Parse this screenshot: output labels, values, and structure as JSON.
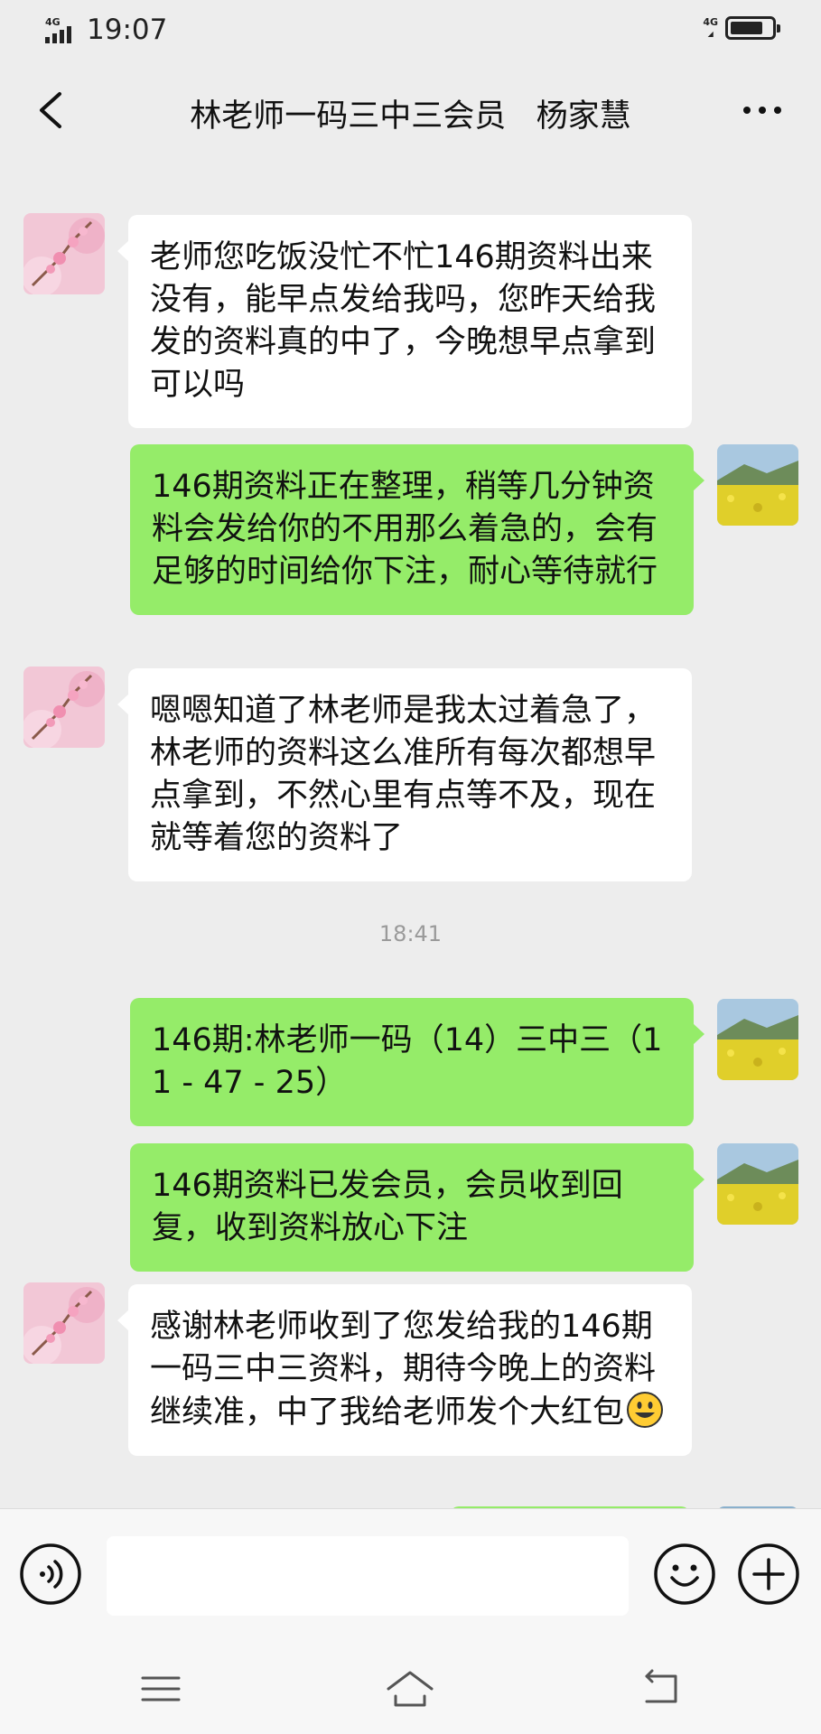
{
  "status_bar": {
    "time": "19:07",
    "signal_label": "4G",
    "battery_label": "4G"
  },
  "header": {
    "title": "林老师一码三中三会员   杨家慧"
  },
  "chat": {
    "timestamps": [
      "18:41"
    ],
    "messages": [
      {
        "side": "in",
        "text": "老师您吃饭没忙不忙146期资料出来没有，能早点发给我吗，您昨天给我发的资料真的中了，今晚想早点拿到可以吗"
      },
      {
        "side": "out",
        "text": "146期资料正在整理，稍等几分钟资料会发给你的不用那么着急的，会有足够的时间给你下注，耐心等待就行"
      },
      {
        "side": "in",
        "text": "嗯嗯知道了林老师是我太过着急了，林老师的资料这么准所有每次都想早点拿到，不然心里有点等不及，现在就等着您的资料了"
      },
      {
        "side": "out",
        "text": "146期:林老师一码（14）三中三（11 - 47 - 25）"
      },
      {
        "side": "out",
        "text": "146期资料已发会员，会员收到回复，收到资料放心下注"
      },
      {
        "side": "in",
        "text": "感谢林老师收到了您发给我的146期一码三中三资料，期待今晚上的资料继续准，中了我给老师发个大红包",
        "emoji": "grinning-face"
      }
    ]
  },
  "input_bar": {
    "voice_icon": "voice-icon",
    "emoji_icon": "emoji-icon",
    "plus_icon": "plus-icon"
  },
  "colors": {
    "background": "#ededed",
    "incoming_bubble": "#ffffff",
    "outgoing_bubble": "#95ec69",
    "timestamp": "#9a9a9a"
  }
}
